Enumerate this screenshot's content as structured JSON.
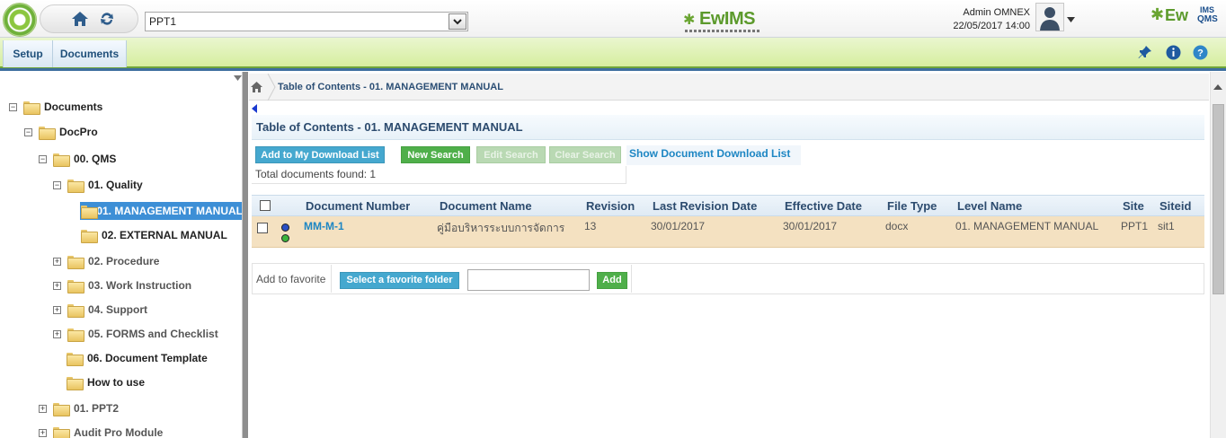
{
  "header": {
    "site_selected": "PPT1",
    "center_logo_text": "EwIMS",
    "user_name": "Admin OMNEX",
    "datetime": "22/05/2017 14:00",
    "right_logo_text": "Ew",
    "right_logo_ims": "IMS",
    "right_logo_qms": "QMS"
  },
  "menu": {
    "setup": "Setup",
    "documents": "Documents"
  },
  "tree": {
    "root": "Documents",
    "docpro": "DocPro",
    "qms": "00. QMS",
    "quality": "01. Quality",
    "mgmt_manual": "01. MANAGEMENT MANUAL",
    "external_manual": "02. EXTERNAL MANUAL",
    "procedure": "02. Procedure",
    "work_instruction": "03. Work Instruction",
    "support": "04. Support",
    "forms": "05. FORMS and Checklist",
    "doc_template": "06. Document Template",
    "how_to_use": "How to use",
    "ppt2": "01. PPT2",
    "audit_pro": "Audit Pro Module"
  },
  "main": {
    "breadcrumb": "Table of Contents - 01. MANAGEMENT MANUAL",
    "title": "Table of Contents - 01. MANAGEMENT MANUAL",
    "buttons": {
      "add_download": "Add to My Download List",
      "new_search": "New Search",
      "edit_search": "Edit Search",
      "clear_search": "Clear Search",
      "show_download": "Show Document Download List"
    },
    "total_found": "Total documents found: 1",
    "columns": {
      "doc_number": "Document Number",
      "doc_name": "Document Name",
      "revision": "Revision",
      "last_rev_date": "Last Revision Date",
      "effective_date": "Effective Date",
      "file_type": "File Type",
      "level_name": "Level Name",
      "site": "Site",
      "siteid": "Siteid"
    },
    "rows": [
      {
        "doc_number": "MM-M-1",
        "doc_name": "คู่มือบริหารระบบการจัดการ",
        "revision": "13",
        "last_rev_date": "30/01/2017",
        "effective_date": "30/01/2017",
        "file_type": "docx",
        "level_name": "01. MANAGEMENT MANUAL",
        "site": "PPT1",
        "siteid": "sit1",
        "status_colors": [
          "#2a4fc4",
          "#3cb43c"
        ]
      }
    ],
    "favorite": {
      "label": "Add to favorite",
      "select_folder": "Select a favorite folder",
      "input_value": "",
      "add": "Add"
    }
  },
  "colors": {
    "accent_blue": "#45a8cf",
    "accent_green": "#4faf4a",
    "selected_row": "#f4e1c1",
    "tree_selected": "#3d8fd6"
  }
}
